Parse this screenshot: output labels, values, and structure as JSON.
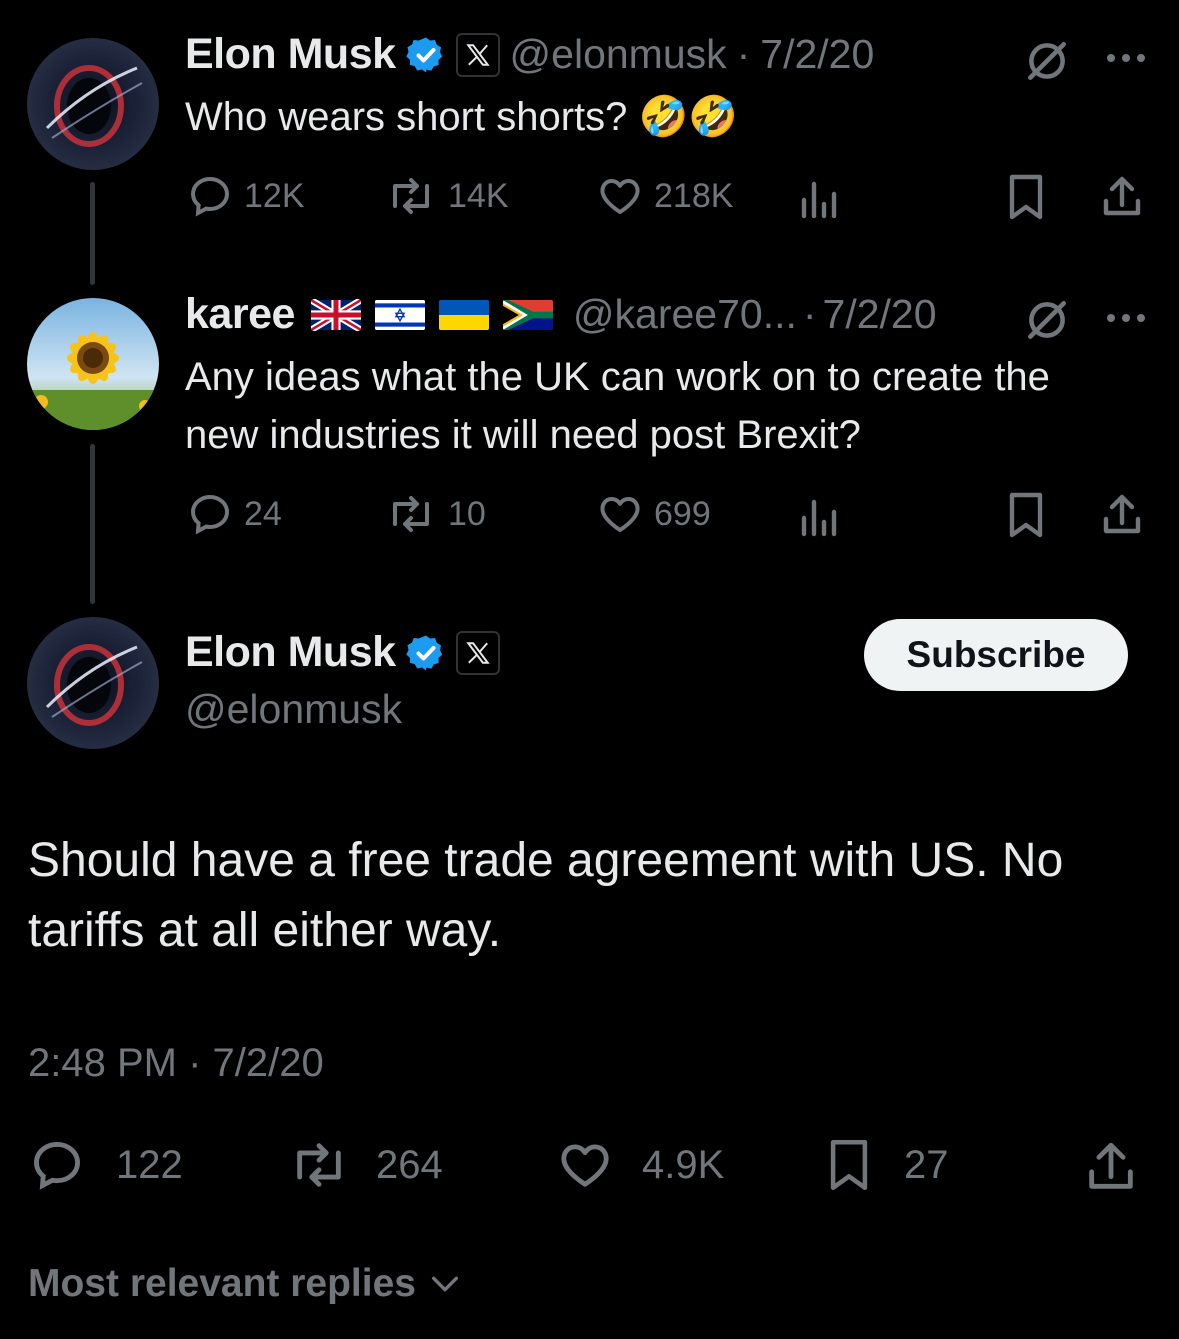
{
  "tweet1": {
    "name": "Elon Musk",
    "handle": "@elonmusk",
    "dot": "·",
    "date": "7/2/20",
    "text": "Who wears short shorts? 🤣🤣",
    "replies": "12K",
    "retweets": "14K",
    "likes": "218K"
  },
  "tweet2": {
    "name": "karee",
    "handle": "@karee70...",
    "dot": "·",
    "date": "7/2/20",
    "text": "Any ideas what the UK can work on to create the new industries it will need post Brexit?",
    "replies": "24",
    "retweets": "10",
    "likes": "699"
  },
  "main": {
    "name": "Elon Musk",
    "handle": "@elonmusk",
    "subscribe_label": "Subscribe",
    "text": "Should have a free trade agreement with US. No tariffs at all either way.",
    "timestamp": "2:48 PM · 7/2/20",
    "replies": "122",
    "retweets": "264",
    "likes": "4.9K",
    "bookmarks": "27"
  },
  "sort": {
    "label": "Most relevant replies"
  },
  "colors": {
    "verified": "#1d9bf0",
    "muted": "#71767b",
    "text": "#e7e9ea"
  }
}
